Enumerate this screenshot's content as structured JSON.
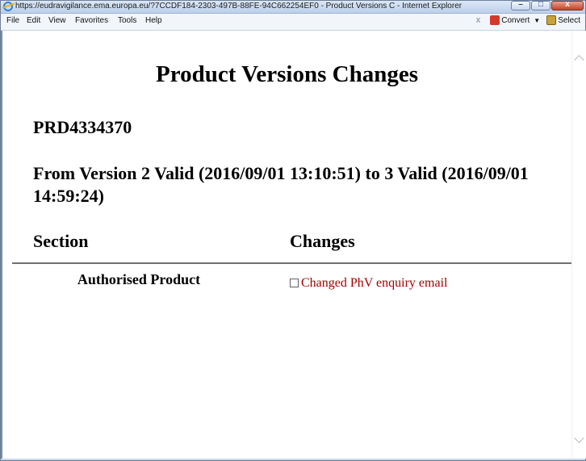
{
  "window": {
    "title": "https://eudravigilance.ema.europa.eu/?7CCDF184-2303-497B-88FE-94C662254EF0 - Product Versions C - Internet Explorer"
  },
  "menu": {
    "items": [
      "File",
      "Edit",
      "View",
      "Favorites",
      "Tools",
      "Help"
    ],
    "close_glyph": "x",
    "convert_label": "Convert",
    "select_label": "Select"
  },
  "page": {
    "heading": "Product Versions Changes",
    "product_id": "PRD4334370",
    "version_line": "From Version 2 Valid (2016/09/01 13:10:51) to 3 Valid (2016/09/01 14:59:24)",
    "columns": {
      "section": "Section",
      "changes": "Changes"
    },
    "rows": [
      {
        "section": "Authorised Product",
        "change": "Changed PhV enquiry email"
      }
    ],
    "change_color": "#a30000"
  }
}
